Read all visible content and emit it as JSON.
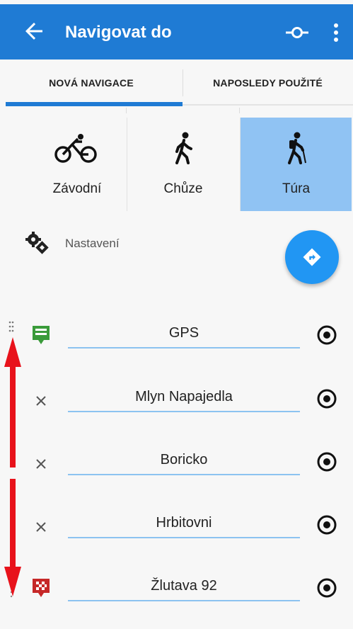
{
  "appbar": {
    "title": "Navigovat do",
    "back_icon": "arrow-left-icon",
    "route_icon": "route-point-icon",
    "menu_icon": "more-vertical-icon",
    "color": "#1f7bd4"
  },
  "tabs": [
    {
      "label": "NOVÁ NAVIGACE",
      "active": true
    },
    {
      "label": "NAPOSLEDY POUŽITÉ",
      "active": false
    }
  ],
  "modes": [
    {
      "label": "Závodní",
      "icon": "bicycle-icon",
      "selected": false
    },
    {
      "label": "Chůze",
      "icon": "walking-icon",
      "selected": false
    },
    {
      "label": "Túra",
      "icon": "hiking-icon",
      "selected": true
    }
  ],
  "settings": {
    "label": "Nastavení",
    "icon": "settings-gears-icon"
  },
  "fab": {
    "icon": "navigate-diamond-icon"
  },
  "route_points": [
    {
      "value": "GPS",
      "lead": "start-flag-icon"
    },
    {
      "value": "Mlyn Napajedla",
      "lead": "remove-icon"
    },
    {
      "value": "Boricko",
      "lead": "remove-icon"
    },
    {
      "value": "Hrbitovni",
      "lead": "remove-icon"
    },
    {
      "value": "Žlutava 92",
      "lead": "finish-flag-icon"
    }
  ],
  "colors": {
    "accent": "#2196f3",
    "selected_mode": "#90c3f3",
    "start": "#3a9b3a",
    "finish": "#c62828",
    "annotation": "#e8121b"
  }
}
